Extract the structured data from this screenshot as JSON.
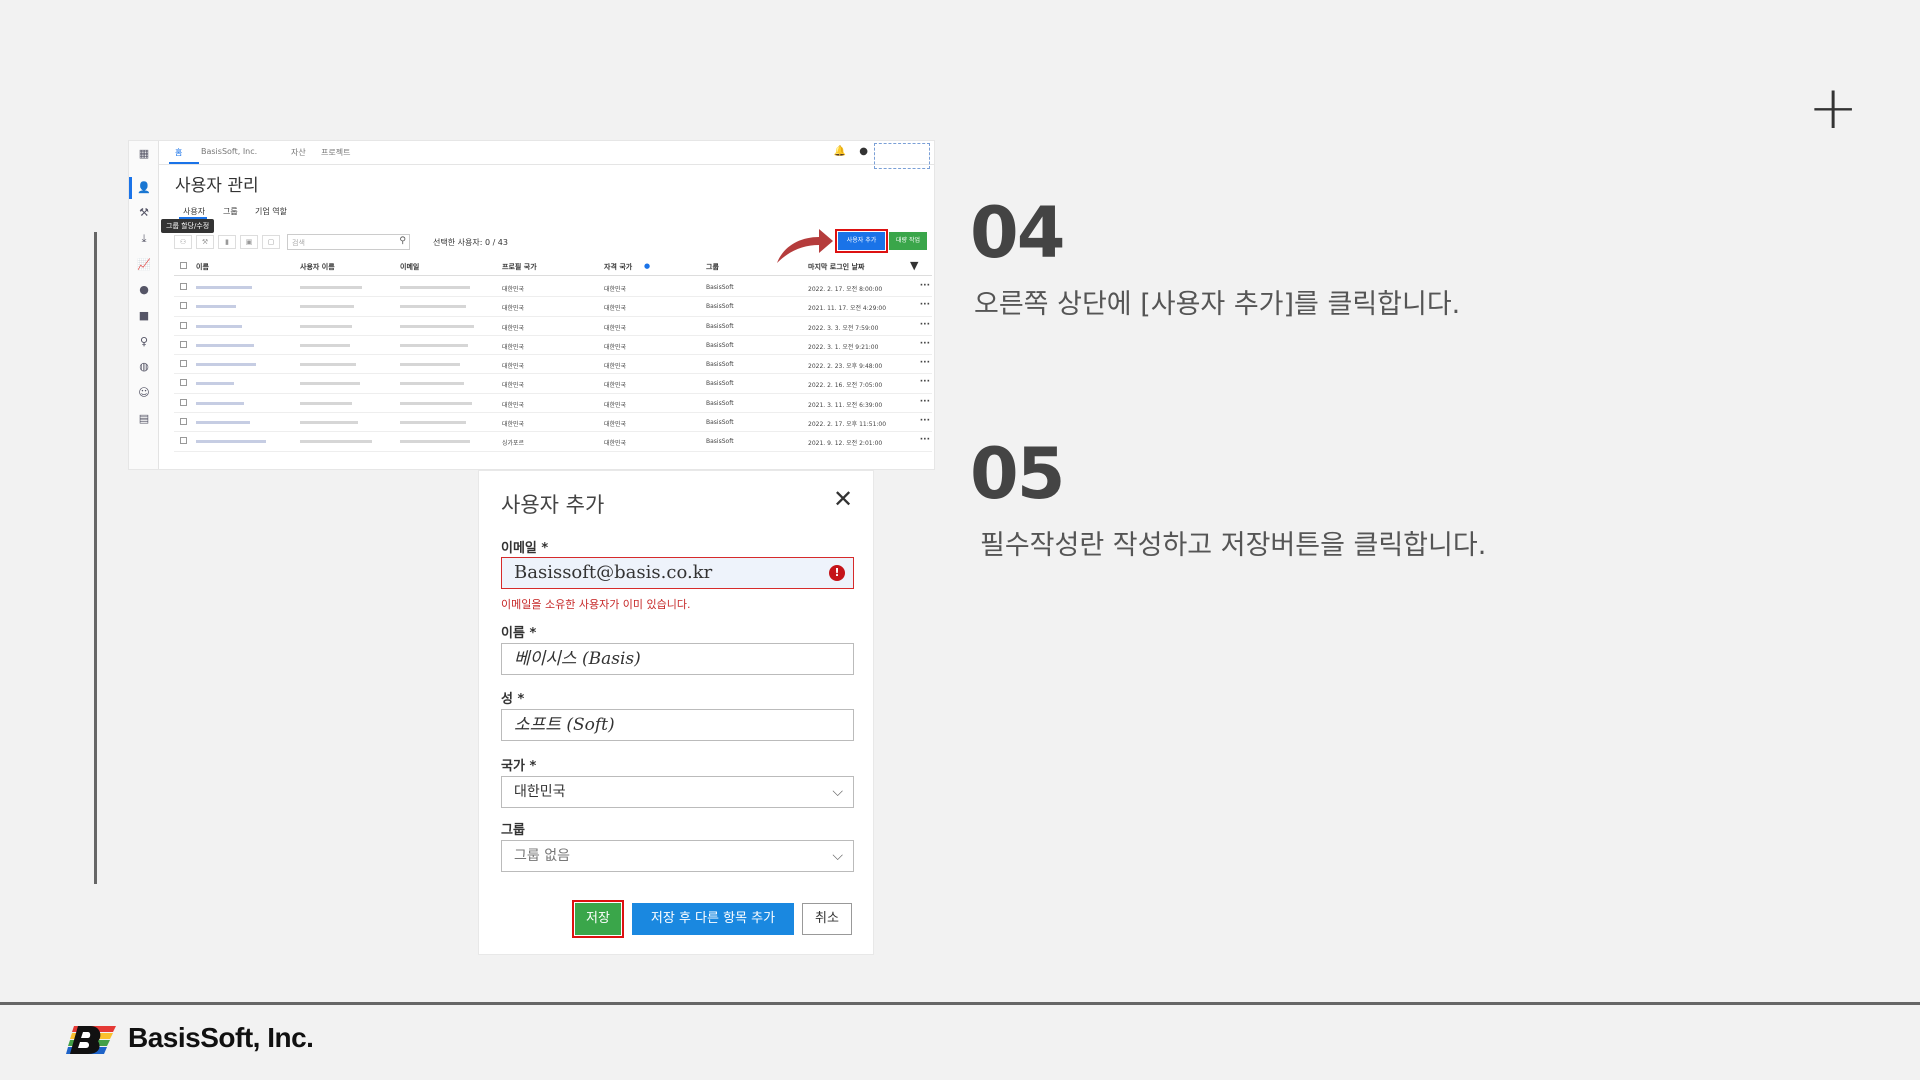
{
  "steps": [
    {
      "num": "04",
      "desc": "오른쪽 상단에 [사용자 추가]를 클릭합니다."
    },
    {
      "num": "05",
      "desc": "필수작성란 작성하고 저장버튼을 클릭합니다."
    }
  ],
  "screenshot": {
    "tabs": [
      "홈",
      "BasisSoft, Inc.",
      "자산",
      "프로젝트"
    ],
    "page_title": "사용자 관리",
    "subtabs": [
      "사용자",
      "그룹",
      "기업 역할"
    ],
    "tooltip": "그룹 할당/수정",
    "search_placeholder": "검색",
    "selected_count": "선택한 사용자: 0 / 43",
    "add_user_button": "사용자 추가",
    "bulk_button": "대량 작업",
    "columns": [
      "이름",
      "사용자 이름",
      "이메일",
      "프로필 국가",
      "자격 국가",
      "그룹",
      "마지막 로그인 날짜"
    ],
    "rows": [
      {
        "country": "대한민국",
        "cred": "대한민국",
        "group": "BasisSoft",
        "last": "2022. 2. 17. 오전 8:00:00"
      },
      {
        "country": "대한민국",
        "cred": "대한민국",
        "group": "BasisSoft",
        "last": "2021. 11. 17. 오전 4:29:00"
      },
      {
        "country": "대한민국",
        "cred": "대한민국",
        "group": "BasisSoft",
        "last": "2022. 3. 3. 오전 7:59:00"
      },
      {
        "country": "대한민국",
        "cred": "대한민국",
        "group": "BasisSoft",
        "last": "2022. 3. 1. 오전 9:21:00"
      },
      {
        "country": "대한민국",
        "cred": "대한민국",
        "group": "BasisSoft",
        "last": "2022. 2. 23. 오후 9:48:00"
      },
      {
        "country": "대한민국",
        "cred": "대한민국",
        "group": "BasisSoft",
        "last": "2022. 2. 16. 오전 7:05:00"
      },
      {
        "country": "대한민국",
        "cred": "대한민국",
        "group": "BasisSoft",
        "last": "2021. 3. 11. 오전 6:39:00"
      },
      {
        "country": "대한민국",
        "cred": "대한민국",
        "group": "BasisSoft",
        "last": "2022. 2. 17. 오후 11:51:00"
      },
      {
        "country": "싱가포르",
        "cred": "대한민국",
        "group": "BasisSoft",
        "last": "2021. 9. 12. 오전 2:01:00"
      }
    ]
  },
  "dialog": {
    "title": "사용자 추가",
    "email_label": "이메일 *",
    "email_value": "Basissoft@basis.co.kr",
    "email_error": "이메일을 소유한 사용자가 이미 있습니다.",
    "first_label": "이름 *",
    "first_value": "베이시스 (Basis)",
    "last_label": "성 *",
    "last_value": "소프트 (Soft)",
    "country_label": "국가 *",
    "country_value": "대한민국",
    "group_label": "그룹",
    "group_value": "그룹 없음",
    "save": "저장",
    "save_more": "저장 후 다른 항목 추가",
    "cancel": "취소"
  },
  "footer": {
    "company": "BasisSoft, Inc."
  },
  "colors": {
    "accent": "#1a73e8",
    "save_green": "#3aa64a",
    "error": "#d62b2b",
    "highlight": "#d11111"
  }
}
